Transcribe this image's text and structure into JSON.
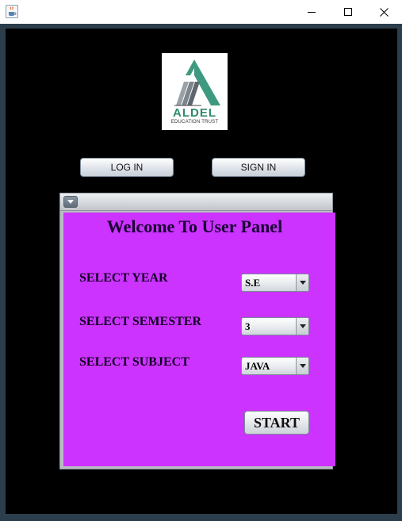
{
  "window": {
    "icon": "java-cup-icon",
    "controls": [
      "minimize-icon",
      "maximize-icon",
      "close-icon"
    ]
  },
  "logo": {
    "name": "ALDEL",
    "subtitle": "EDUCATION TRUST"
  },
  "top_buttons": {
    "login_label": "LOG IN",
    "signin_label": "SIGN IN"
  },
  "panel": {
    "title": "Welcome To User Panel",
    "background_color": "#cc33ff",
    "fields": {
      "year": {
        "label": "SELECT YEAR",
        "value": "S.E"
      },
      "semester": {
        "label": "SELECT SEMESTER",
        "value": "3"
      },
      "subject": {
        "label": "SELECT SUBJECT",
        "value": "JAVA"
      }
    },
    "start_label": "START"
  },
  "colors": {
    "frame": "#2c3e4c",
    "content_bg": "#000000",
    "logo_green": "#2e8a6e"
  }
}
